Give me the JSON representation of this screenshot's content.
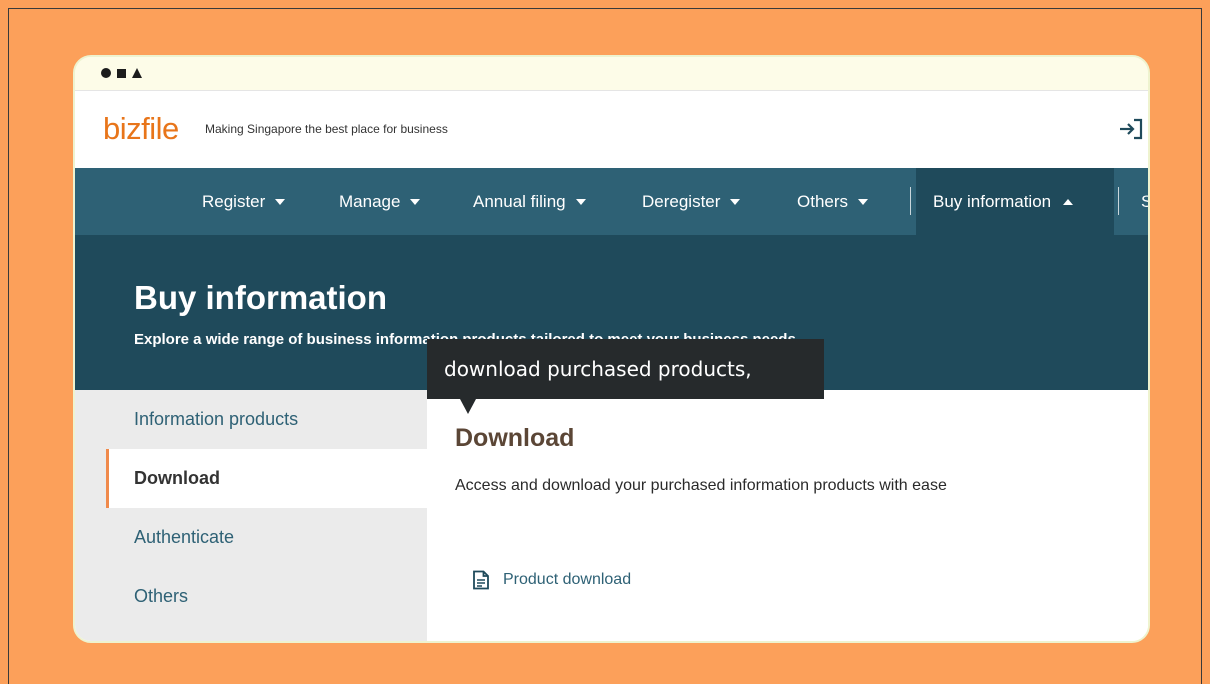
{
  "header": {
    "logo": "bizfile",
    "tagline": "Making Singapore the best place for business",
    "login_icon": "login-icon"
  },
  "nav": {
    "items": [
      {
        "label": "Register"
      },
      {
        "label": "Manage"
      },
      {
        "label": "Annual filing"
      },
      {
        "label": "Deregister"
      },
      {
        "label": "Others"
      },
      {
        "label": "Buy information"
      },
      {
        "label": "S"
      }
    ]
  },
  "banner": {
    "title": "Buy information",
    "subtitle": "Explore a wide range of business information products tailored to meet your business needs"
  },
  "tooltip": {
    "text": "download purchased products,"
  },
  "sidebar": {
    "items": [
      {
        "label": "Information products"
      },
      {
        "label": "Download"
      },
      {
        "label": "Authenticate"
      },
      {
        "label": "Others"
      }
    ]
  },
  "content": {
    "title": "Download",
    "description": "Access and download your purchased information products with ease",
    "link_label": "Product download",
    "link_icon": "document-icon"
  },
  "colors": {
    "background": "#fca05a",
    "nav": "#2e6175",
    "banner": "#1f4a5b",
    "accent": "#f08a4b",
    "logo": "#e8751a"
  }
}
